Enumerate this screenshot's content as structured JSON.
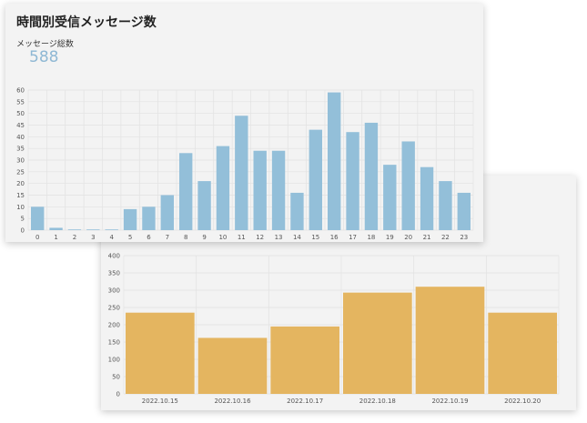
{
  "hourly_card": {
    "title": "時間別受信メッセージ数",
    "total_label": "メッセージ総数",
    "total_value": "588"
  },
  "colors": {
    "hourly_bar": "#93bfd9",
    "daily_bar": "#e4b560",
    "grid": "#e2e2e2",
    "card_bg": "#f3f3f3",
    "total_value": "#8fb8d4"
  },
  "chart_data": [
    {
      "type": "bar",
      "title": "",
      "xlabel": "",
      "ylabel": "",
      "categories": [
        "0",
        "1",
        "2",
        "3",
        "4",
        "5",
        "6",
        "7",
        "8",
        "9",
        "10",
        "11",
        "12",
        "13",
        "14",
        "15",
        "16",
        "17",
        "18",
        "19",
        "20",
        "21",
        "22",
        "23"
      ],
      "values": [
        10,
        1,
        0.3,
        0.3,
        0.3,
        9,
        10,
        15,
        33,
        21,
        36,
        49,
        34,
        34,
        16,
        43,
        59,
        42,
        46,
        28,
        38,
        27,
        21,
        16
      ],
      "ylim": [
        0,
        60
      ],
      "yticks": [
        0,
        5,
        10,
        15,
        20,
        25,
        30,
        35,
        40,
        45,
        50,
        55,
        60
      ],
      "grid": true
    },
    {
      "type": "bar",
      "title": "",
      "xlabel": "",
      "ylabel": "",
      "categories": [
        "2022.10.15",
        "2022.10.16",
        "2022.10.17",
        "2022.10.18",
        "2022.10.19",
        "2022.10.20"
      ],
      "values": [
        235,
        162,
        195,
        293,
        310,
        235
      ],
      "ylim": [
        0,
        400
      ],
      "yticks": [
        0,
        50,
        100,
        150,
        200,
        250,
        300,
        350,
        400
      ],
      "grid": true
    }
  ]
}
